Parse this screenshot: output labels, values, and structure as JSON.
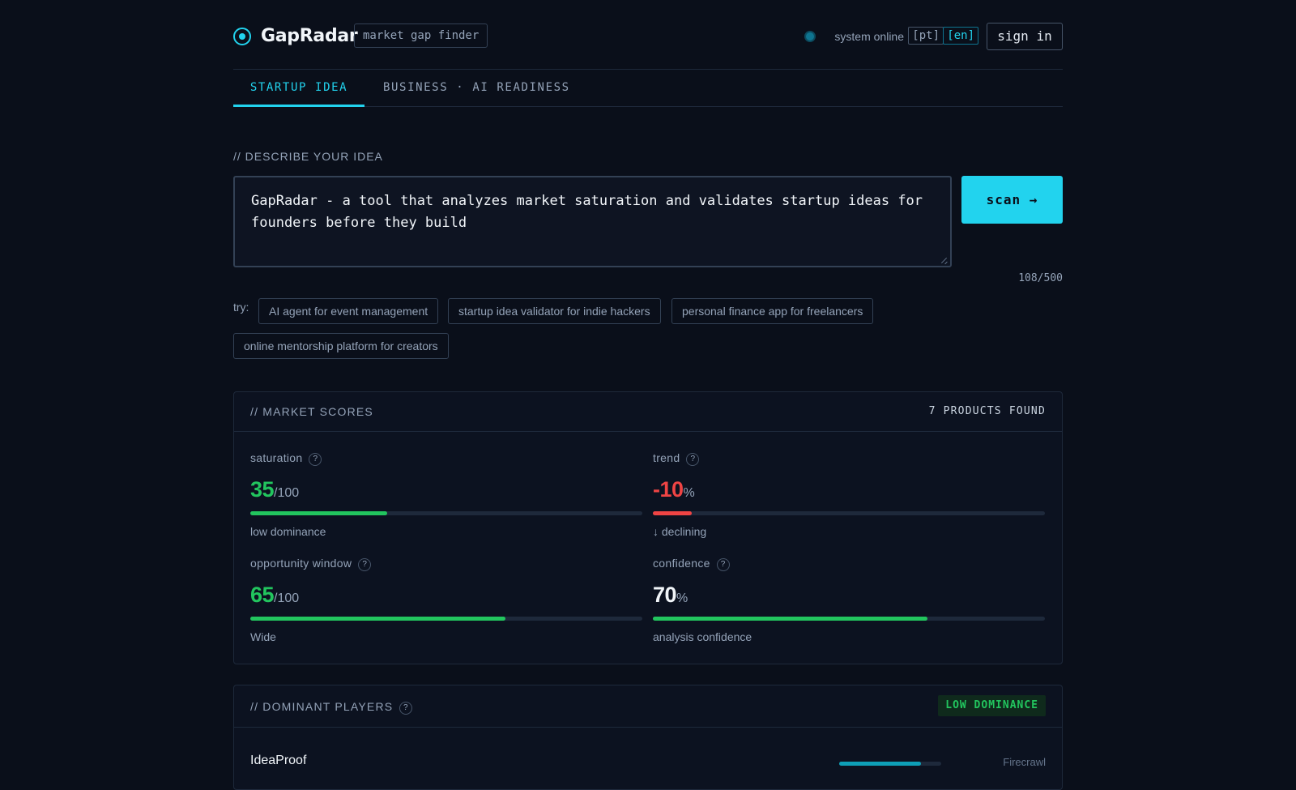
{
  "header": {
    "brand": "GapRadar",
    "tag": "market gap finder",
    "status": "system online",
    "lang_pt": "[pt]",
    "lang_en": "[en]",
    "signin": "sign in"
  },
  "tabs": [
    {
      "label": "STARTUP IDEA",
      "active": true
    },
    {
      "label": "BUSINESS · AI READINESS",
      "active": false
    }
  ],
  "idea": {
    "section_label": "// DESCRIBE YOUR IDEA",
    "value": "GapRadar - a tool that analyzes market saturation and validates startup ideas for founders before they build",
    "scan_label": "scan →",
    "counter": "108/500",
    "try_label": "try:",
    "suggestions": [
      "AI agent for event management",
      "startup idea validator for indie hackers",
      "personal finance app for freelancers",
      "online mentorship platform for creators"
    ]
  },
  "scores": {
    "title": "// MARKET SCORES",
    "products_found": "7 PRODUCTS FOUND",
    "help": "?",
    "metrics": [
      {
        "label": "saturation",
        "value": "35",
        "unit": "/100",
        "fill": 0.35,
        "sub": "low dominance",
        "color": "#22c55e"
      },
      {
        "label": "trend",
        "value": "-10",
        "unit": "%",
        "fill": 0.1,
        "sub": "↓ declining",
        "color": "#ef4444"
      },
      {
        "label": "opportunity window",
        "value": "65",
        "unit": "/100",
        "fill": 0.65,
        "sub": "Wide",
        "color": "#22c55e"
      },
      {
        "label": "confidence",
        "value": "70",
        "unit": "%",
        "fill": 0.7,
        "sub": "analysis confidence",
        "color": "#22c55e"
      }
    ]
  },
  "players": {
    "title": "// DOMINANT PLAYERS",
    "badge": "LOW DOMINANCE",
    "items": [
      {
        "name": "IdeaProof",
        "fill": 0.8,
        "source": "Firecrawl"
      }
    ]
  }
}
